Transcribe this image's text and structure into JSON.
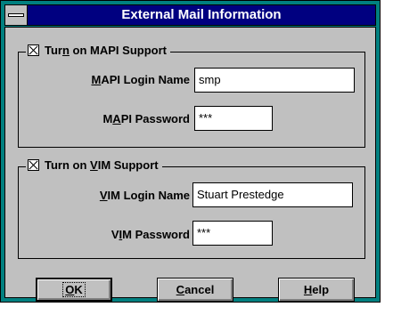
{
  "dialog": {
    "title": "External Mail Information"
  },
  "mapi": {
    "checkbox_label": "Turn on MAPI Support",
    "checked": true,
    "login_label": "MAPI Login Name",
    "login_value": "smp",
    "password_label": "MAPI Password",
    "password_value": "***"
  },
  "vim": {
    "checkbox_label": "Turn on VIM Support",
    "checked": true,
    "login_label": "VIM Login Name",
    "login_value": "Stuart Prestedge",
    "password_label": "VIM Password",
    "password_value": "***"
  },
  "buttons": {
    "ok": "OK",
    "cancel": "Cancel",
    "help": "Help"
  }
}
